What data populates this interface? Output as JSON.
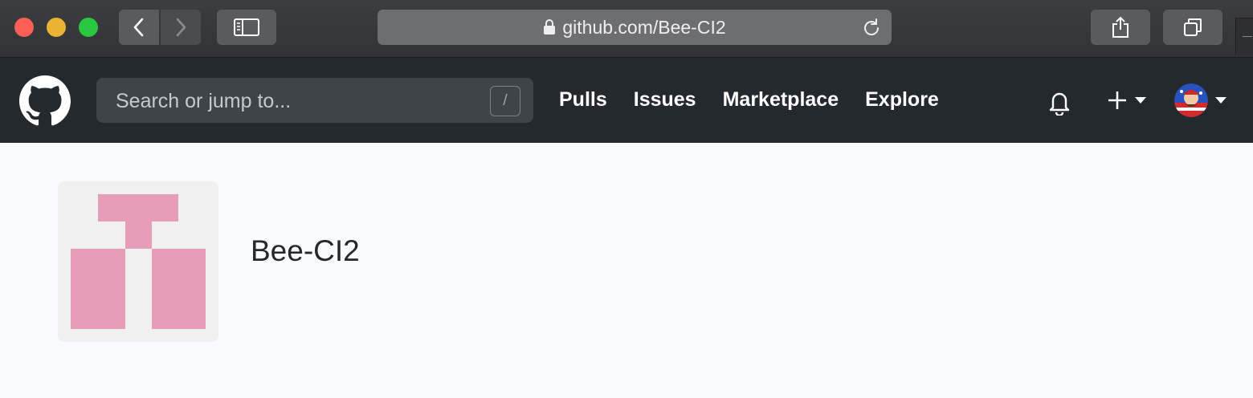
{
  "browser": {
    "url": "github.com/Bee-CI2",
    "icons": [
      "back-icon",
      "forward-icon",
      "sidebar-icon",
      "lock-icon",
      "reload-icon",
      "share-icon",
      "tabs-icon"
    ]
  },
  "header": {
    "search_placeholder": "Search or jump to...",
    "search_shortcut": "/",
    "nav": [
      {
        "label": "Pulls"
      },
      {
        "label": "Issues"
      },
      {
        "label": "Marketplace"
      },
      {
        "label": "Explore"
      }
    ],
    "icons": [
      "github-logo-icon",
      "bell-icon",
      "plus-icon",
      "caret-down-icon",
      "avatar"
    ]
  },
  "profile": {
    "name": "Bee-CI2"
  },
  "colors": {
    "header_bg": "#24292e",
    "identicon": "#e79cb8",
    "identicon_bg": "#f0f0f0",
    "page_bg": "#fafbfc"
  }
}
